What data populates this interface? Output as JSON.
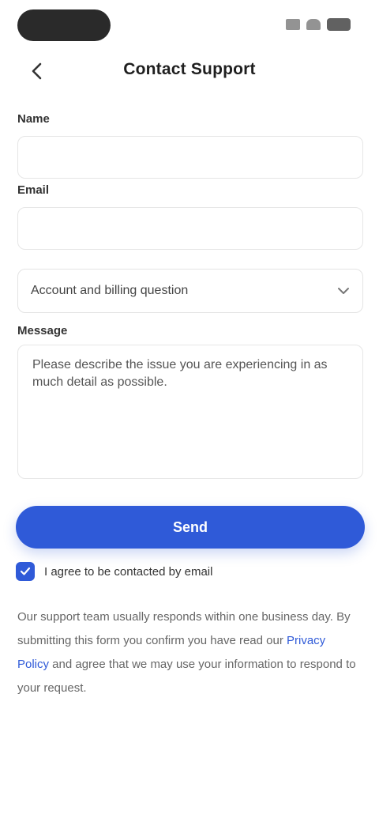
{
  "status_bar": {
    "icons": [
      "signal-icon",
      "wifi-icon",
      "battery-icon"
    ]
  },
  "header": {
    "title": "Contact Support",
    "back_icon": "chevron-left-icon"
  },
  "form": {
    "name_label": "Name",
    "name_value": "",
    "email_label": "Email",
    "email_value": "",
    "topic_value": "Account and billing question",
    "topic_icon": "chevron-down-icon",
    "message_label": "Message",
    "message_value": "Please describe the issue you are experiencing in as much detail as possible."
  },
  "actions": {
    "submit_label": "Send"
  },
  "consent": {
    "checked": true,
    "label": "I agree to be contacted by email"
  },
  "disclaimer": {
    "text_before": "Our support team usually responds within one business day. By submitting this form you confirm you have read our ",
    "link_text": "Privacy Policy",
    "text_after": " and agree that we may use your information to respond to your request."
  },
  "colors": {
    "accent": "#2f5ad8",
    "text": "#222222",
    "border": "#e6e6e6"
  }
}
